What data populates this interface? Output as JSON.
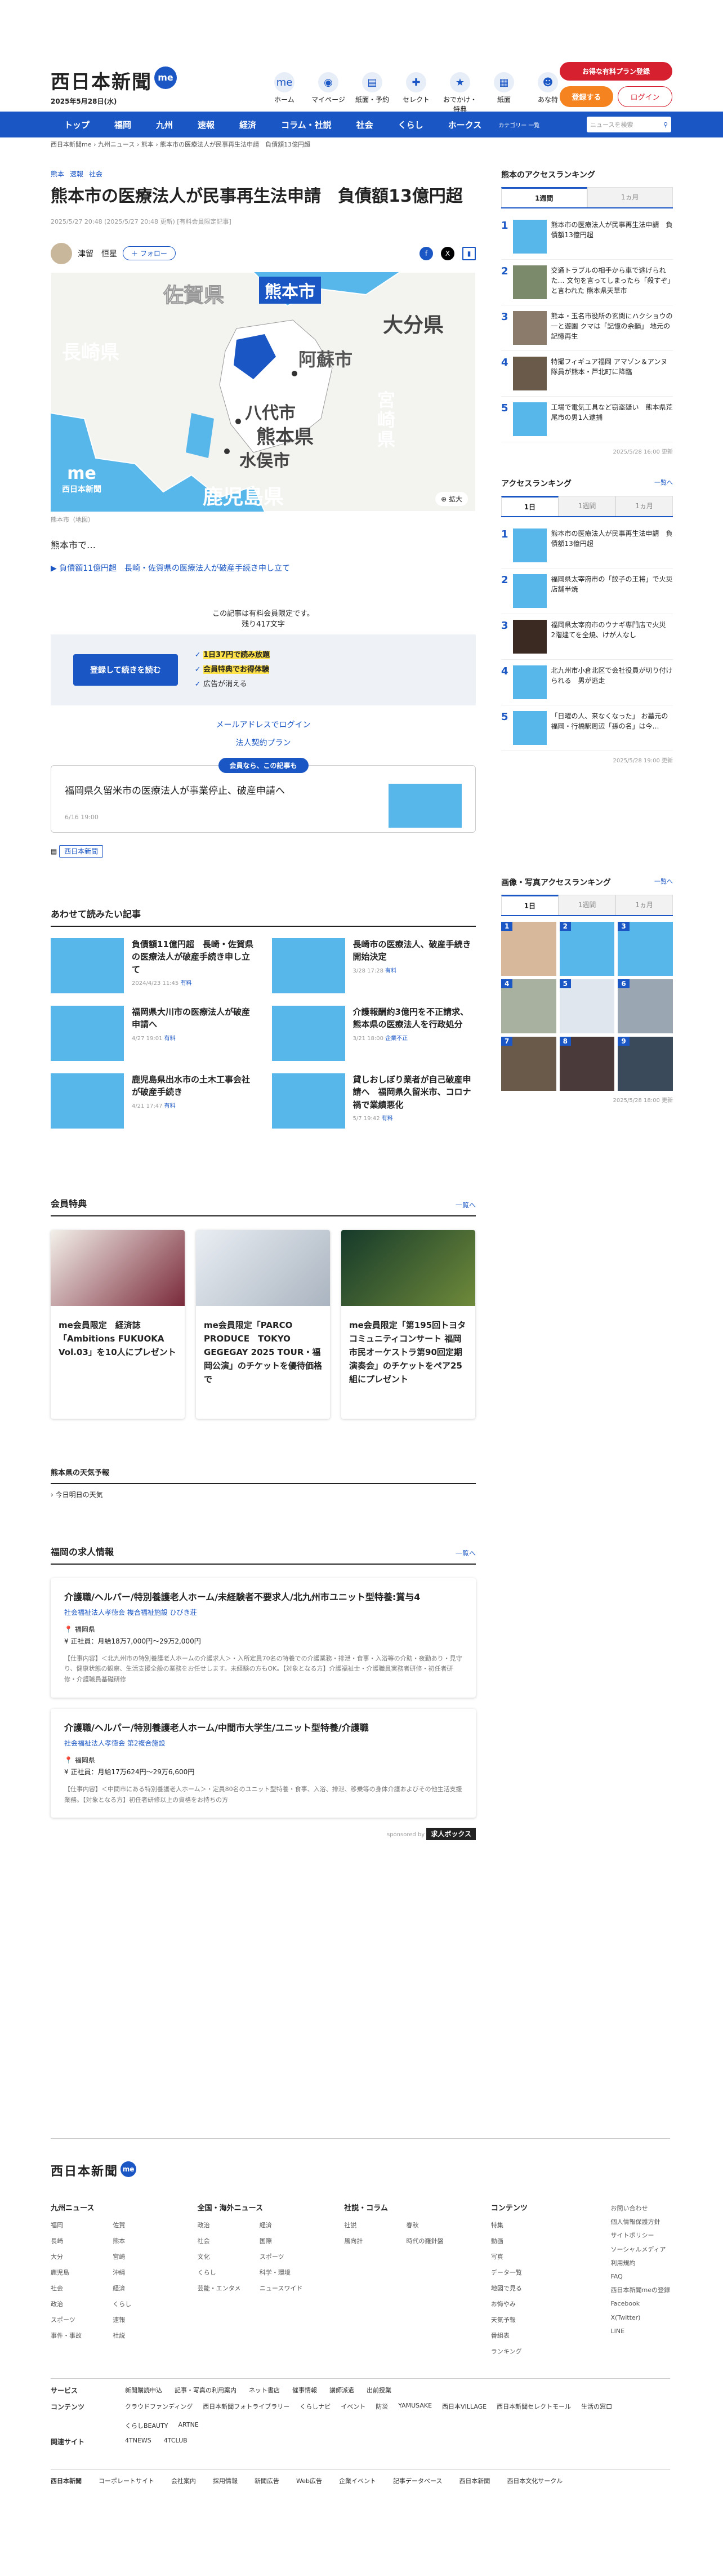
{
  "header": {
    "logo": "西日本新聞",
    "logo_badge": "me",
    "logo_caption": "西日本新聞me",
    "date": "2025年5月28日(水)",
    "nav": [
      {
        "label": "ホーム",
        "icon": "me-icon"
      },
      {
        "label": "マイページ",
        "icon": "user-icon"
      },
      {
        "label": "紙面・予約",
        "icon": "paper-icon"
      },
      {
        "label": "セレクト",
        "icon": "select-icon"
      },
      {
        "label": "おでかけ・特典",
        "icon": "outing-icon"
      },
      {
        "label": "紙面",
        "icon": "newspaper-icon"
      },
      {
        "label": "あな特",
        "icon": "anatoku-icon"
      }
    ],
    "plan_button": "お得な有料プラン登録",
    "register_button": "登録する",
    "login_button": "ログイン"
  },
  "gnav": {
    "items": [
      "トップ",
      "福岡",
      "九州",
      "速報",
      "経済",
      "コラム・社説",
      "社会",
      "くらし",
      "ホークス"
    ],
    "category": "カテゴリー 一覧",
    "search_placeholder": "ニュースを検索"
  },
  "breadcrumb": [
    "西日本新聞me",
    "九州ニュース",
    "熊本",
    "熊本市の医療法人が民事再生法申請　負債額13億円超"
  ],
  "article": {
    "tags": [
      "熊本",
      "速報",
      "社会"
    ],
    "title": "熊本市の医療法人が民事再生法申請　負債額13億円超",
    "meta": "2025/5/27 20:48 (2025/5/27 20:48 更新) [有料会員限定記事]",
    "author": "津留　恒星",
    "follow": "＋ フォロー",
    "map_labels": [
      "佐賀県",
      "熊本市",
      "長崎県",
      "阿蘇市",
      "大分県",
      "八代市",
      "熊本県",
      "水俣市",
      "宮崎県",
      "鹿児島県"
    ],
    "map_logo": "西日本新聞",
    "zoom": "拡大",
    "caption": "熊本市（地図）",
    "lead": "熊本市で…",
    "related": "負債額11億円超　長崎・佐賀県の医療法人が破産手続き申し立て",
    "paywall_note": "この記事は有料会員限定です。",
    "remaining": "残り417文字",
    "subscribe_button": "登録して続きを読む",
    "benefits": [
      "1日37円で読み放題",
      "会員特典でお得体験",
      "広告が消える"
    ],
    "email_login": "メールアドレスでログイン",
    "corporate": "法人契約プラン",
    "member_tab": "会員なら、この記事も",
    "member_article": "福岡県久留米市の医療法人が事業停止、破産申請へ",
    "member_date": "6/16 19:00",
    "topic_tag": "西日本新聞"
  },
  "recommend": {
    "heading": "あわせて読みたい記事",
    "items": [
      {
        "title": "負債額11億円超　長崎・佐賀県の医療法人が破産手続き申し立て",
        "date": "2024/4/23 11:45",
        "tag": "有料"
      },
      {
        "title": "長崎市の医療法人、破産手続き開始決定",
        "date": "3/28 17:28",
        "tag": "有料"
      },
      {
        "title": "福岡県大川市の医療法人が破産申請へ",
        "date": "4/27 19:01",
        "tag": "有料"
      },
      {
        "title": "介護報酬約3億円を不正請求、熊本県の医療法人を行政処分",
        "date": "3/21 18:00",
        "tag": "企業不正"
      },
      {
        "title": "鹿児島県出水市の土木工事会社が破産手続き",
        "date": "4/21 17:47",
        "tag": "有料"
      },
      {
        "title": "貸しおしぼり業者が自己破産申請へ　福岡県久留米市、コロナ禍で業績悪化",
        "date": "5/7 19:42",
        "tag": "有料"
      }
    ]
  },
  "perks": {
    "heading": "会員特典",
    "more": "一覧へ",
    "cards": [
      {
        "title": "me会員限定　経済誌「Ambitions FUKUOKA Vol.03」を10人にプレゼント"
      },
      {
        "title": "me会員限定「PARCO PRODUCE　TOKYO GEGEGAY 2025 TOUR・福岡公演」のチケットを優待価格で"
      },
      {
        "title": "me会員限定「第195回トヨタコミュニティコンサート 福岡市民オーケストラ第90回定期演奏会」のチケットをペア25組にプレゼント"
      }
    ]
  },
  "weather": {
    "heading": "熊本県の天気予報",
    "link": "今日明日の天気"
  },
  "jobs": {
    "heading": "福岡の求人情報",
    "more": "一覧へ",
    "items": [
      {
        "title": "介護職/ヘルパー/特別養護老人ホーム/未経験者不要求人/北九州市ユニット型特養:賞与4",
        "company": "社会福祉法人孝徳会 複合福祉施設 ひびき荘",
        "place": "福岡県",
        "salary": "正社員：月給18万7,000円〜29万2,000円",
        "desc": "【仕事内容】＜北九州市の特別養護老人ホームの介護求人＞・入所定員70名の特養での介護業務・排泄・食事・入浴等の介助・夜勤あり・見守り、健康状態の観察、生活支援全般の業務をお任せします。未経験の方もOK。【対象となる方】介護福祉士・介護職員実務者研修・初任者研修・介護職員基礎研修"
      },
      {
        "title": "介護職/ヘルパー/特別養護老人ホーム/中間市大学生/ユニット型特養/介護職",
        "company": "社会福祉法人孝徳会 第2複合施設",
        "place": "福岡県",
        "salary": "正社員：月給17万624円〜29万6,600円",
        "desc": "【仕事内容】＜中間市にある特別養護老人ホーム＞・定員80名のユニット型特養・食事、入浴、排泄、移乗等の身体介護およびその他生活支援業務。【対象となる方】初任者研修以上の資格をお持ちの方"
      }
    ],
    "sponsor_label": "sponsored by",
    "sponsor": "求人ボックス"
  },
  "sidebar": {
    "ranking": {
      "heading": "熊本のアクセスランキング",
      "tabs": [
        "1週間",
        "1ヵ月"
      ],
      "items": [
        "熊本市の医療法人が民事再生法申請　負債額13億円超",
        "交通トラブルの相手から車で逃げられた… 文句を言ってしまったら「殺すぞ」と言われた 熊本県天草市",
        "熊本・玉名市役所の玄関にハクショウの一と遊園 クマは「記憶の余韻」 地元の記憶再生",
        "特撮フィギュア福岡 アマゾン＆アンヌ隊員が熊本・芦北町に降臨",
        "工場で電気工具など窃盗疑い　熊本県荒尾市の男1人逮捕"
      ],
      "stamp": "2025/5/28 16:00 更新"
    },
    "access": {
      "heading": "アクセスランキング",
      "more": "一覧へ",
      "tabs": [
        "1日",
        "1週間",
        "1ヵ月"
      ],
      "items": [
        "熊本市の医療法人が民事再生法申請　負債額13億円超",
        "福岡県太宰府市の「餃子の王将」で火災　店舗半焼",
        "福岡県太宰府市のウナギ専門店で火災　2階建てを全焼、けが人なし",
        "北九州市小倉北区で会社役員が切り付けられる　男が逃走",
        "「日曜の人、来なくなった」 お墓元の福岡・行橋駅周辺「孫の名」は今…"
      ],
      "stamp": "2025/5/28 19:00 更新"
    },
    "photo": {
      "heading": "画像・写真アクセスランキング",
      "more": "一覧へ",
      "tabs": [
        "1日",
        "1週間",
        "1ヵ月"
      ],
      "stamp": "2025/5/28 18:00 更新"
    }
  },
  "footer": {
    "logo": "西日本新聞",
    "cols": [
      {
        "heading": "九州ニュース",
        "items": [
          "福岡",
          "佐賀",
          "長崎",
          "熊本",
          "大分",
          "宮崎",
          "鹿児島",
          "沖縄",
          "社会",
          "経済",
          "政治",
          "くらし",
          "スポーツ",
          "速報",
          "事件・事故",
          "社説"
        ]
      },
      {
        "heading": "全国・海外ニュース",
        "items": [
          "政治",
          "経済",
          "社会",
          "国際",
          "文化",
          "スポーツ",
          "くらし",
          "科学・環境",
          "芸能・エンタメ",
          "ニュースワイド"
        ]
      },
      {
        "heading": "社説・コラム",
        "items": [
          "社説",
          "春秋",
          "風向計",
          "時代の羅針盤"
        ]
      },
      {
        "heading": "コンテンツ",
        "items": [
          "特集",
          "動画",
          "写真",
          "データ一覧",
          "地図で見る",
          "お悔やみ",
          "天気予報",
          "番組表",
          "ランキング"
        ]
      }
    ],
    "misc": [
      "お問い合わせ",
      "個人情報保護方針",
      "サイトポリシー",
      "ソーシャルメディア",
      "利用規約",
      "FAQ",
      "西日本新聞meの登録",
      "Facebook",
      "X(Twitter)",
      "LINE"
    ],
    "service_label": "サービス",
    "service": [
      "新聞購読申込",
      "記事・写真の利用案内",
      "ネット書店",
      "催事情報",
      "講師派遣",
      "出前授業"
    ],
    "content_label": "コンテンツ",
    "content": [
      "クラウドファンディング",
      "西日本新聞フォトライブラリー",
      "くらしナビ",
      "イベント",
      "防災",
      "YAMUSAKE",
      "西日本VILLAGE",
      "西日本新聞セレクトモール",
      "生活の窓口",
      "くらしBEAUTY",
      "ARTNE"
    ],
    "related_label": "関連サイト",
    "related": [
      "4TNEWS",
      "4TCLUB"
    ],
    "bottom": [
      "コーポレートサイト",
      "会社案内",
      "採用情報",
      "新聞広告",
      "Web広告",
      "企業イベント",
      "記事データベース",
      "西日本新聞",
      "西日本文化サークル"
    ]
  },
  "colors": {
    "brand": "#1a56c4",
    "accent": "#d6202f",
    "orange": "#f5831f",
    "sea": "#58b7ea"
  }
}
